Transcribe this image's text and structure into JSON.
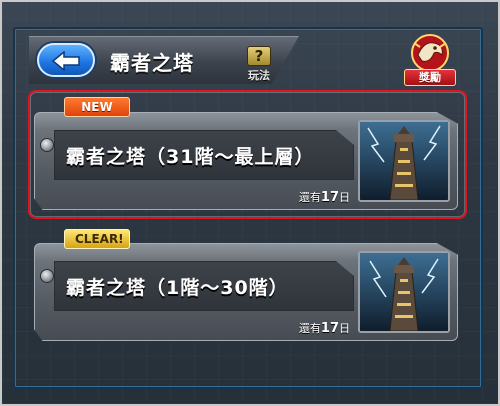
{
  "header": {
    "title": "霸者之塔",
    "help_label": "玩法",
    "help_symbol": "?"
  },
  "reward": {
    "label": "獎勵"
  },
  "cards": [
    {
      "tag": "NEW",
      "title": "霸者之塔（31階～最上層）",
      "remaining_prefix": "還有",
      "remaining_days": "17",
      "remaining_suffix": "日",
      "selected": true
    },
    {
      "tag": "CLEAR!",
      "title": "霸者之塔（1階～30階）",
      "remaining_prefix": "還有",
      "remaining_days": "17",
      "remaining_suffix": "日",
      "selected": false
    }
  ],
  "colors": {
    "selection": "#e0141e",
    "new_tag": "#ff6a1e",
    "clear_tag": "#f3c73a",
    "back_button": "#1d74e0"
  },
  "icons": {
    "back": "left-arrow-icon",
    "help": "question-icon",
    "reward": "dragon-emblem-icon",
    "thumbnail": "storm-tower-image"
  }
}
